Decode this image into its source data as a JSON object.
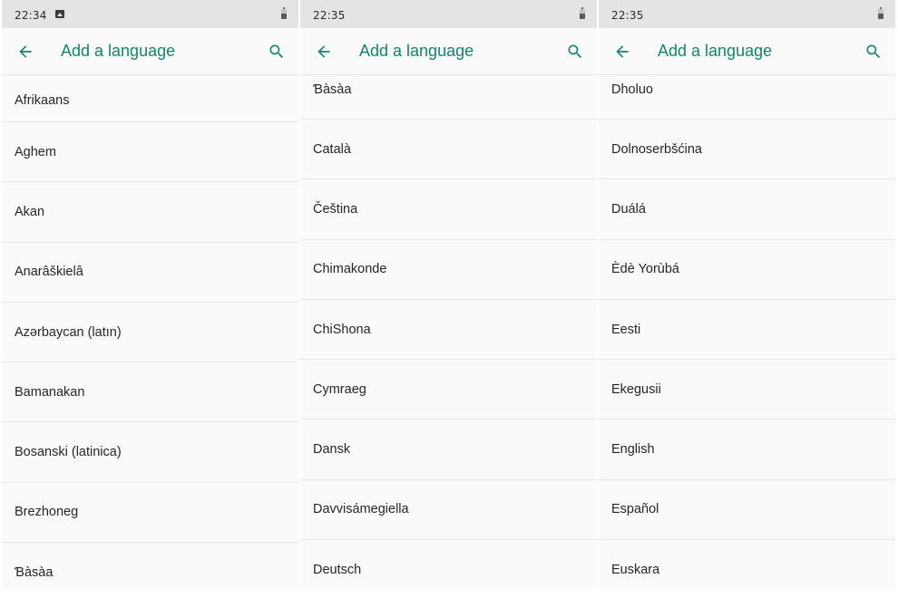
{
  "screens": [
    {
      "status_time": "22:34",
      "show_image_icon": true,
      "title": "Add a language",
      "items": [
        "Afrikaans",
        "Aghem",
        "Akan",
        "Anarâškielâ",
        "Azərbaycan (latın)",
        "Bamanakan",
        "Bosanski (latinica)",
        "Brezhoneg",
        "Ɓàsàa"
      ]
    },
    {
      "status_time": "22:35",
      "show_image_icon": false,
      "title": "Add a language",
      "items": [
        "Ɓàsàa",
        "Català",
        "Čeština",
        "Chimakonde",
        "ChiShona",
        "Cymraeg",
        "Dansk",
        "Davvisámegiella",
        "Deutsch"
      ]
    },
    {
      "status_time": "22:35",
      "show_image_icon": false,
      "title": "Add a language",
      "items": [
        "Dholuo",
        "Dolnoserbšćina",
        "Duálá",
        "Èdè Yorùbá",
        "Eesti",
        "Ekegusii",
        "English",
        "Español",
        "Euskara"
      ]
    }
  ],
  "colors": {
    "accent": "#128570",
    "status_bar": "#e4e4e4",
    "background": "#fafafa",
    "divider": "#e6e6e6",
    "text": "#262626"
  },
  "icons": {
    "back": "arrow-left-icon",
    "search": "search-icon",
    "battery": "battery-icon",
    "image": "image-icon"
  }
}
